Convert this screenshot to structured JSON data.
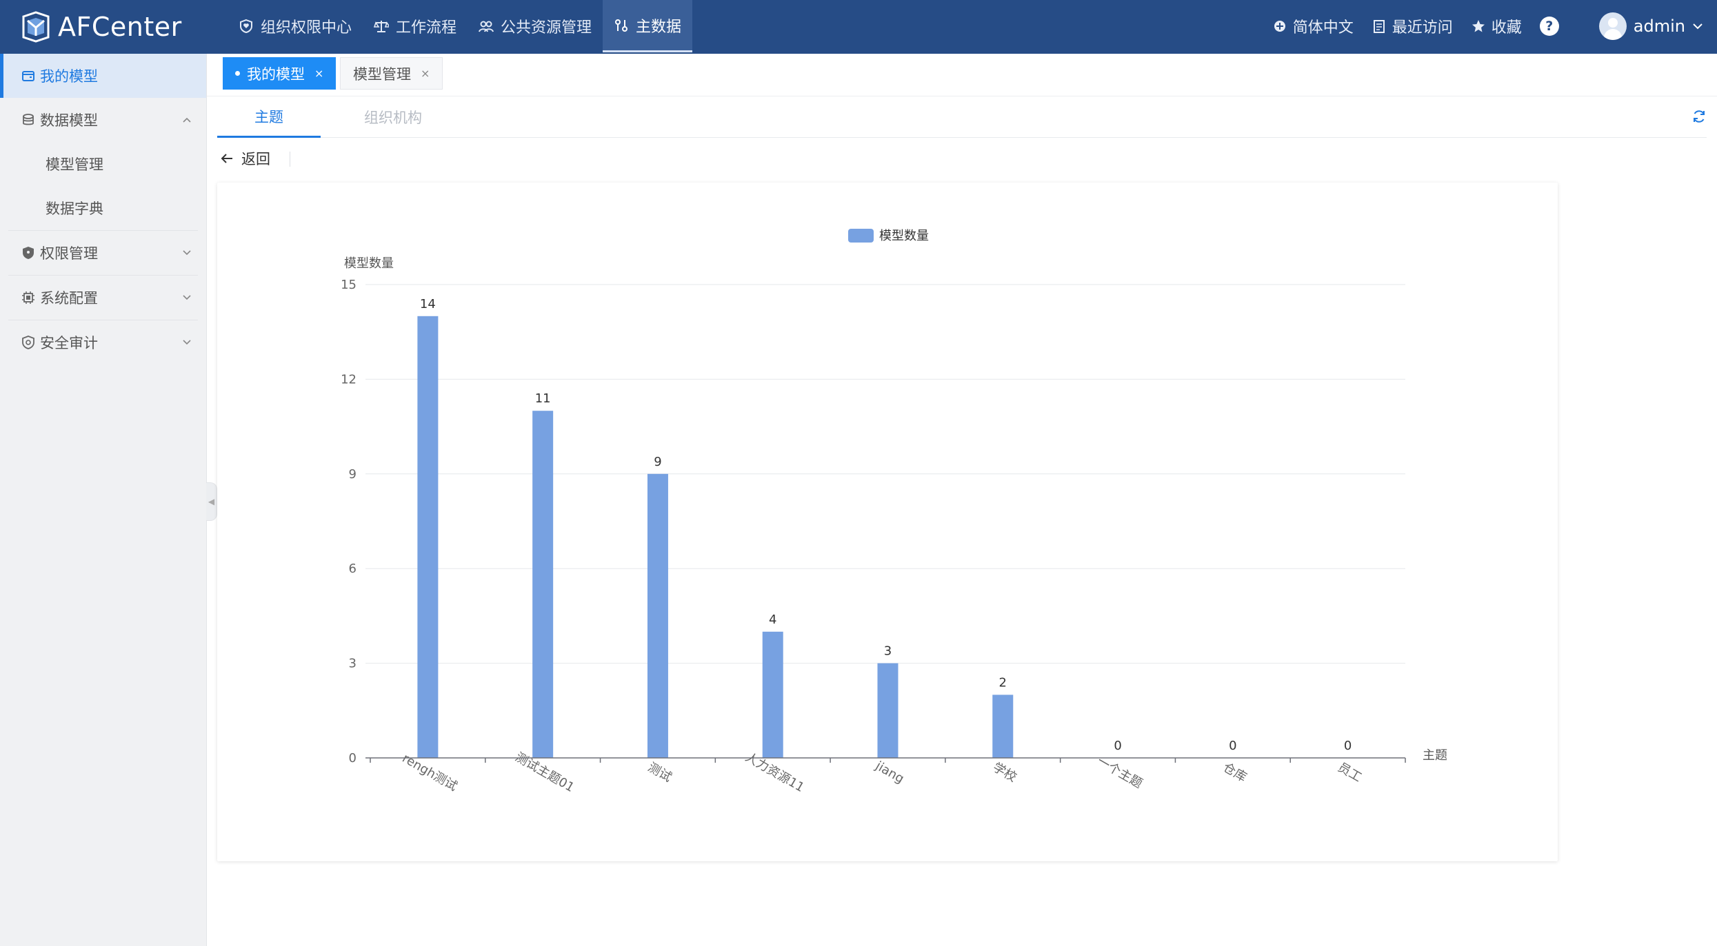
{
  "app": {
    "name": "AFCenter"
  },
  "nav": {
    "items": [
      {
        "label": "组织权限中心",
        "icon": "shield-heart-icon"
      },
      {
        "label": "工作流程",
        "icon": "scale-icon"
      },
      {
        "label": "公共资源管理",
        "icon": "group-icon"
      },
      {
        "label": "主数据",
        "icon": "data-icon"
      }
    ]
  },
  "topright": {
    "language": "简体中文",
    "recent": "最近访问",
    "favorites": "收藏",
    "help": "?",
    "user": "admin"
  },
  "sidebar": {
    "my_models": "我的模型",
    "data_models": "数据模型",
    "model_management": "模型管理",
    "data_dictionary": "数据字典",
    "permission_management": "权限管理",
    "system_config": "系统配置",
    "security_audit": "安全审计"
  },
  "tabs": {
    "active": "我的模型",
    "second": "模型管理",
    "close": "×"
  },
  "subtabs": {
    "topic": "主题",
    "org": "组织机构"
  },
  "back": {
    "label": "返回"
  },
  "colors": {
    "topbar": "#264c86",
    "accent": "#1f7ae0",
    "bar": "#77a1e1"
  },
  "chart_data": {
    "type": "bar",
    "legend": "模型数量",
    "ylabel": "模型数量",
    "xlabel": "主题",
    "categories": [
      "rengh测试",
      "测试主题01",
      "测试",
      "人力资源11",
      "jiang",
      "学校",
      "一个主题",
      "仓库",
      "员工"
    ],
    "values": [
      14,
      11,
      9,
      4,
      3,
      2,
      0,
      0,
      0
    ],
    "ylim": [
      0,
      15
    ],
    "yticks": [
      0,
      3,
      6,
      9,
      12,
      15
    ],
    "grid": true,
    "legend_position": "top-center",
    "data_labels": true
  }
}
